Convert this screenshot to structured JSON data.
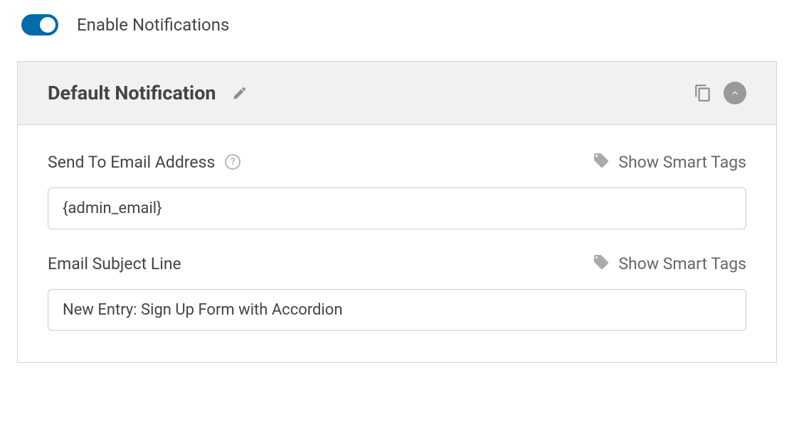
{
  "enable": {
    "label": "Enable Notifications",
    "on": true
  },
  "panel": {
    "title": "Default Notification"
  },
  "fields": {
    "sendTo": {
      "label": "Send To Email Address",
      "value": "{admin_email}",
      "showSmartTags": "Show Smart Tags"
    },
    "subject": {
      "label": "Email Subject Line",
      "value": "New Entry: Sign Up Form with Accordion",
      "showSmartTags": "Show Smart Tags"
    }
  }
}
